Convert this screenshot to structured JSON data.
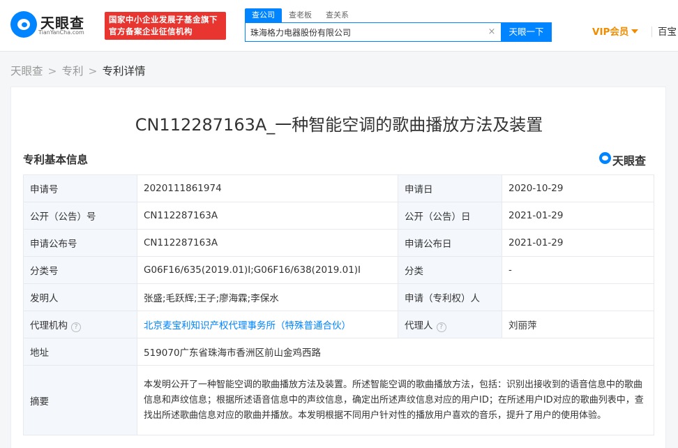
{
  "header": {
    "logo_name": "天眼查",
    "logo_sub": "TianYanCha.com",
    "badge_line1": "国家中小企业发展子基金旗下",
    "badge_line2": "官方备案企业征信机构",
    "search_tabs": [
      "查公司",
      "查老板",
      "查关系"
    ],
    "search_value": "珠海格力电器股份有限公司",
    "search_button": "天眼一下",
    "vip_label": "VIP会员",
    "right_link": "百宝"
  },
  "breadcrumb": {
    "home": "天眼查",
    "section": "专利",
    "current": "专利详情"
  },
  "patent": {
    "title": "CN112287163A_一种智能空调的歌曲播放方法及装置",
    "section_title": "专利基本信息",
    "watermark": "天眼查",
    "fields": {
      "app_no_label": "申请号",
      "app_no": "2020111861974",
      "app_date_label": "申请日",
      "app_date": "2020-10-29",
      "pub_no_label": "公开（公告）号",
      "pub_no": "CN112287163A",
      "pub_date_label": "公开（公告）日",
      "pub_date": "2021-01-29",
      "app_pub_no_label": "申请公布号",
      "app_pub_no": "CN112287163A",
      "app_pub_date_label": "申请公布日",
      "app_pub_date": "2021-01-29",
      "class_no_label": "分类号",
      "class_no": "G06F16/635(2019.01)I;G06F16/638(2019.01)I",
      "class_label": "分类",
      "class": "-",
      "inventor_label": "发明人",
      "inventor": "张盛;毛跃辉;王子;廖海霖;李保水",
      "applicant_label": "申请（专利权）人",
      "applicant": "",
      "agency_label": "代理机构",
      "agency": "北京麦宝利知识产权代理事务所（特殊普通合伙）",
      "agent_label": "代理人",
      "agent": "刘丽萍",
      "address_label": "地址",
      "address": "519070广东省珠海市香洲区前山金鸡西路",
      "abstract_label": "摘要",
      "abstract": "本发明公开了一种智能空调的歌曲播放方法及装置。所述智能空调的歌曲播放方法，包括：识别出接收到的语音信息中的歌曲信息和声纹信息；根据所述语音信息中的声纹信息，确定出所述声纹信息对应的用户ID；在所述用户ID对应的歌曲列表中，查找出所述歌曲信息对应的歌曲并播放。本发明根据不同用户针对性的播放用户喜欢的音乐，提升了用户的使用体验。"
    }
  },
  "icons": {
    "help": "?",
    "clear": "×"
  }
}
